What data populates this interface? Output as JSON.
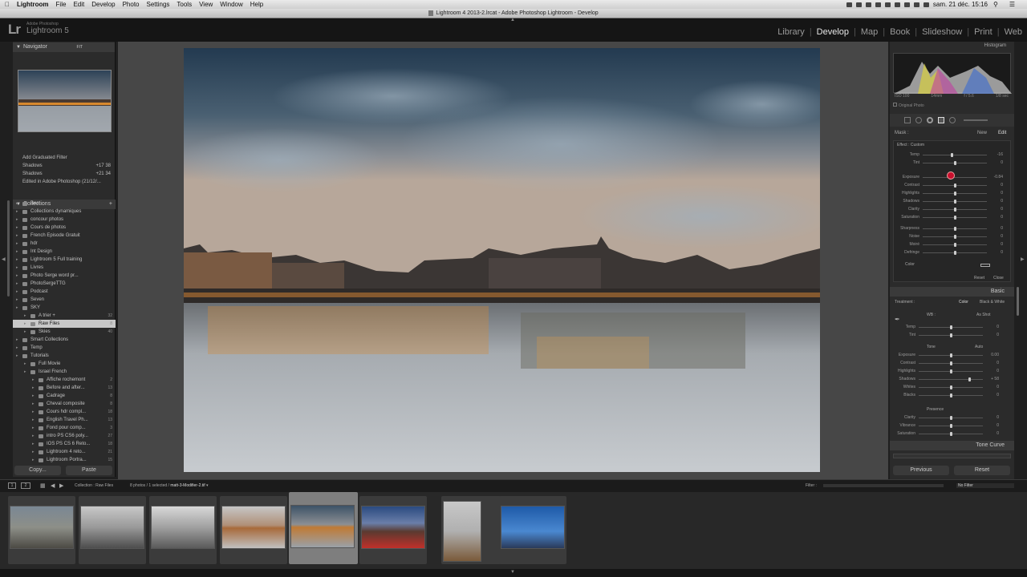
{
  "menubar": {
    "app": "Lightroom",
    "items": [
      "File",
      "Edit",
      "Develop",
      "Photo",
      "Settings",
      "Tools",
      "View",
      "Window",
      "Help"
    ],
    "clock": "sam. 21 déc. 15:16"
  },
  "window_title": "Lightroom 4 2013-2.lrcat - Adobe Photoshop Lightroom - Develop",
  "brand": {
    "logo": "Lr",
    "sub": "Adobe Photoshop",
    "name": "Lightroom 5"
  },
  "modules": [
    "Library",
    "Develop",
    "Map",
    "Book",
    "Slideshow",
    "Print",
    "Web"
  ],
  "active_module": "Develop",
  "navigator": {
    "title": "Navigator",
    "options": "FIT"
  },
  "history": [
    {
      "label": "Add Graduated Filter",
      "a": "",
      "b": ""
    },
    {
      "label": "Shadows",
      "a": "+17",
      "b": "38"
    },
    {
      "label": "Shadows",
      "a": "+21",
      "b": "34"
    },
    {
      "label": "Edited in Adobe Photoshop (21/12/...",
      "a": "",
      "b": ""
    }
  ],
  "collections": {
    "title": "Collections",
    "items": [
      {
        "label": "Best",
        "count": "",
        "indent": 1,
        "sel": false
      },
      {
        "label": "Collections dynamiques",
        "count": "",
        "indent": 1,
        "sel": false
      },
      {
        "label": "concour photos",
        "count": "",
        "indent": 1,
        "sel": false
      },
      {
        "label": "Cours de photos",
        "count": "",
        "indent": 1,
        "sel": false
      },
      {
        "label": "French Episode Gratuit",
        "count": "",
        "indent": 1,
        "sel": false
      },
      {
        "label": "hdr",
        "count": "",
        "indent": 1,
        "sel": false
      },
      {
        "label": "Int Design",
        "count": "",
        "indent": 1,
        "sel": false
      },
      {
        "label": "Lightroom 5 Full training",
        "count": "",
        "indent": 1,
        "sel": false
      },
      {
        "label": "Livres",
        "count": "",
        "indent": 1,
        "sel": false
      },
      {
        "label": "Photo Serge word pr...",
        "count": "",
        "indent": 1,
        "sel": false
      },
      {
        "label": "PhotoSergeTTG",
        "count": "",
        "indent": 1,
        "sel": false
      },
      {
        "label": "Podcast",
        "count": "",
        "indent": 1,
        "sel": false
      },
      {
        "label": "Seven",
        "count": "",
        "indent": 1,
        "sel": false
      },
      {
        "label": "SKY",
        "count": "",
        "indent": 1,
        "sel": false
      },
      {
        "label": "A trier +",
        "count": "32",
        "indent": 2,
        "sel": false
      },
      {
        "label": "Raw Files",
        "count": "8",
        "indent": 2,
        "sel": true
      },
      {
        "label": "Skies",
        "count": "40",
        "indent": 2,
        "sel": false
      },
      {
        "label": "Smart Collections",
        "count": "",
        "indent": 1,
        "sel": false
      },
      {
        "label": "Temp",
        "count": "",
        "indent": 1,
        "sel": false
      },
      {
        "label": "Tutorials",
        "count": "",
        "indent": 1,
        "sel": false
      },
      {
        "label": "Full Movie",
        "count": "",
        "indent": 2,
        "sel": false
      },
      {
        "label": "Israel French",
        "count": "",
        "indent": 2,
        "sel": false
      },
      {
        "label": "Affiche rochemont",
        "count": "2",
        "indent": 3,
        "sel": false
      },
      {
        "label": "Before and after...",
        "count": "13",
        "indent": 3,
        "sel": false
      },
      {
        "label": "Cadrage",
        "count": "8",
        "indent": 3,
        "sel": false
      },
      {
        "label": "Cheval composite",
        "count": "8",
        "indent": 3,
        "sel": false
      },
      {
        "label": "Cours hdr compl...",
        "count": "18",
        "indent": 3,
        "sel": false
      },
      {
        "label": "English Travel Ph...",
        "count": "13",
        "indent": 3,
        "sel": false
      },
      {
        "label": "Fond pour comp...",
        "count": "3",
        "indent": 3,
        "sel": false
      },
      {
        "label": "intro PS CS6 poly...",
        "count": "27",
        "indent": 3,
        "sel": false
      },
      {
        "label": "IOS PS CS 6 Reto...",
        "count": "18",
        "indent": 3,
        "sel": false
      },
      {
        "label": "Lightroom 4 reto...",
        "count": "21",
        "indent": 3,
        "sel": false
      },
      {
        "label": "Lightroom Portra...",
        "count": "15",
        "indent": 3,
        "sel": false
      }
    ]
  },
  "buttons": {
    "copy": "Copy...",
    "paste": "Paste",
    "previous": "Previous",
    "reset": "Reset"
  },
  "histogram": {
    "title": "Histogram",
    "iso": "ISO 100",
    "focal": "14mm",
    "aperture": "f / 5.6",
    "shutter": "1/8 sec",
    "original": "Original Photo"
  },
  "mask": {
    "label": "Mask :",
    "new": "New",
    "edit": "Edit",
    "effect": "Effect :",
    "preset": "Custom"
  },
  "mask_sliders": [
    {
      "name": "Temp",
      "pos": 0.45,
      "val": "-16"
    },
    {
      "name": "Tint",
      "pos": 0.5,
      "val": "0"
    },
    {
      "name": "Exposure",
      "pos": 0.42,
      "val": "-0.84"
    },
    {
      "name": "Contrast",
      "pos": 0.5,
      "val": "0"
    },
    {
      "name": "Highlights",
      "pos": 0.5,
      "val": "0"
    },
    {
      "name": "Shadows",
      "pos": 0.5,
      "val": "0"
    },
    {
      "name": "Clarity",
      "pos": 0.5,
      "val": "0"
    },
    {
      "name": "Saturation",
      "pos": 0.5,
      "val": "0"
    },
    {
      "name": "Sharpness",
      "pos": 0.5,
      "val": "0"
    },
    {
      "name": "Noise",
      "pos": 0.5,
      "val": "0"
    },
    {
      "name": "Moiré",
      "pos": 0.5,
      "val": "0"
    },
    {
      "name": "Defringe",
      "pos": 0.5,
      "val": "0"
    }
  ],
  "mask_color": "Color",
  "mask_footer": {
    "reset": "Reset",
    "close": "Close"
  },
  "basic": {
    "title": "Basic",
    "treatment": "Treatment :",
    "color": "Color",
    "bw": "Black & White",
    "wb": "WB :",
    "as_shot": "As Shot",
    "tone": "Tone",
    "auto": "Auto",
    "presence": "Presence"
  },
  "basic_wb_sliders": [
    {
      "name": "Temp",
      "pos": 0.5,
      "val": "0"
    },
    {
      "name": "Tint",
      "pos": 0.5,
      "val": "0"
    }
  ],
  "basic_tone_sliders": [
    {
      "name": "Exposure",
      "pos": 0.5,
      "val": "0.00"
    },
    {
      "name": "Contrast",
      "pos": 0.5,
      "val": "0"
    },
    {
      "name": "Highlights",
      "pos": 0.5,
      "val": "0"
    },
    {
      "name": "Shadows",
      "pos": 0.79,
      "val": "+ 58"
    },
    {
      "name": "Whites",
      "pos": 0.5,
      "val": "0"
    },
    {
      "name": "Blacks",
      "pos": 0.5,
      "val": "0"
    }
  ],
  "basic_presence_sliders": [
    {
      "name": "Clarity",
      "pos": 0.5,
      "val": "0"
    },
    {
      "name": "Vibrance",
      "pos": 0.5,
      "val": "0"
    },
    {
      "name": "Saturation",
      "pos": 0.5,
      "val": "0"
    }
  ],
  "tone_curve": "Tone Curve",
  "filmstrip": {
    "source": "Collection : Raw Files",
    "info": "8 photos / 1 selected /",
    "file": "matt-3-Modifier-2.tif",
    "filter_label": "Filter :",
    "filter_value": "No Filter"
  }
}
